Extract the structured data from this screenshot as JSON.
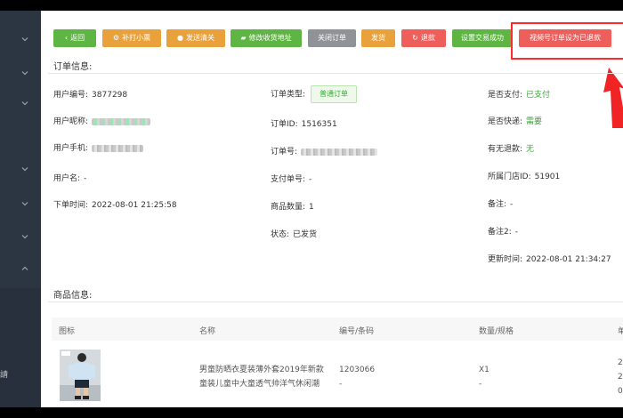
{
  "toolbar": {
    "back": "返回",
    "reprint": "补打小票",
    "customs": "发送清关",
    "modify_address": "修改收货地址",
    "close_order": "关闭订单",
    "ship": "发货",
    "refund": "退款",
    "set_success": "设置交易成功",
    "video_refund": "视频号订单设为已退款"
  },
  "sidebar": {
    "partial_text": "請"
  },
  "order_info": {
    "title": "订单信息:",
    "user_id_label": "用户编号:",
    "user_id": "3877298",
    "nickname_label": "用户昵称:",
    "phone_label": "用户手机:",
    "username_label": "用户名:",
    "username": "-",
    "order_time_label": "下单时间:",
    "order_time": "2022-08-01 21:25:58",
    "order_type_label": "订单类型:",
    "order_type": "普通订单",
    "order_id_label": "订单ID:",
    "order_id": "1516351",
    "order_no_label": "订单号:",
    "pay_no_label": "支付单号:",
    "pay_no": "-",
    "goods_count_label": "商品数量:",
    "goods_count": "1",
    "status_label": "状态:",
    "status": "已发货",
    "paid_label": "是否支付:",
    "paid": "已支付",
    "express_label": "是否快递:",
    "express": "需要",
    "has_refund_label": "有无退款:",
    "has_refund": "无",
    "store_label": "所属门店ID:",
    "store": "51901",
    "remark_label": "备注:",
    "remark": "-",
    "remark2_label": "备注2:",
    "remark2": "-",
    "update_label": "更新时间:",
    "update_time": "2022-08-01 21:34:27"
  },
  "goods_info": {
    "title": "商品信息:",
    "columns": [
      "图标",
      "名称",
      "编号/条码",
      "数量/规格",
      "单"
    ],
    "rows": [
      {
        "name_line1": "男童防晒衣夏装薄外套2019年新款",
        "name_line2": "童装儿童中大童透气帅洋气休闲潮",
        "code": "1203066",
        "code_sub": "-",
        "qty": "X1",
        "qty_sub": "-",
        "price_col": [
          "2",
          "2",
          "0"
        ]
      }
    ]
  },
  "colors": {
    "green": "#5fb544",
    "orange": "#e9a23b",
    "gray": "#8f9398",
    "red": "#ee5f5b",
    "highlight": "#ff2a2a"
  }
}
